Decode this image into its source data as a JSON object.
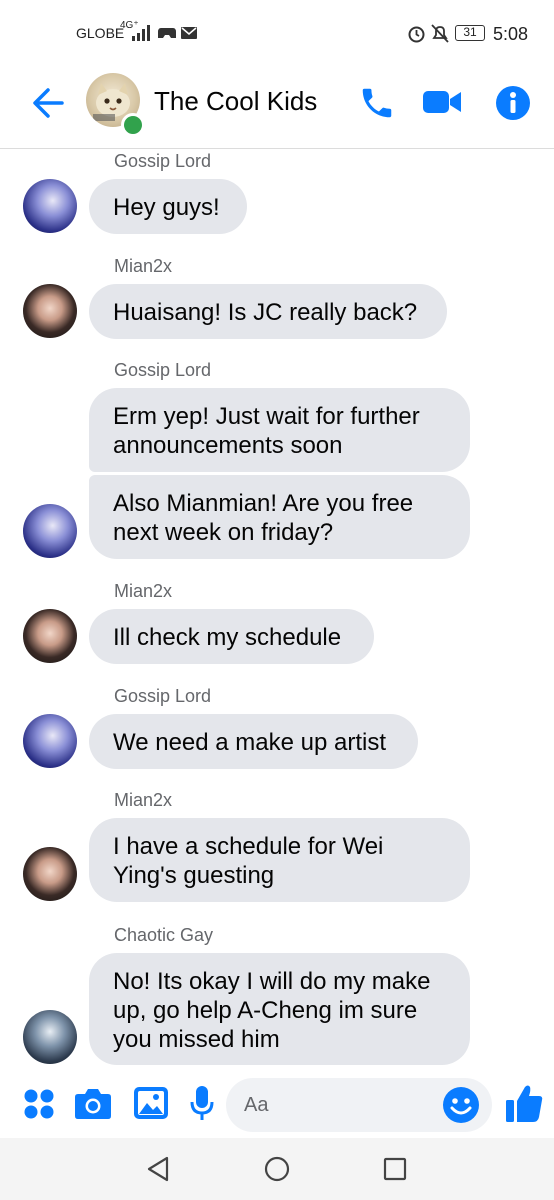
{
  "status_bar": {
    "carrier": "GLOBE",
    "network": "4G⁺",
    "battery": "31",
    "time": "5:08"
  },
  "header": {
    "title": "The Cool Kids",
    "icons": [
      "back-arrow-icon",
      "phone-icon",
      "video-camera-icon",
      "info-icon"
    ]
  },
  "messages": [
    {
      "sender": "Gossip Lord",
      "bubbles": [
        "Hey guys!"
      ]
    },
    {
      "sender": "Mian2x",
      "bubbles": [
        "Huaisang! Is JC really back?"
      ]
    },
    {
      "sender": "Gossip Lord",
      "bubbles": [
        "Erm yep! Just wait for further\nannouncements soon",
        "Also Mianmian! Are you free\nnext week on friday?"
      ]
    },
    {
      "sender": "Mian2x",
      "bubbles": [
        "Ill check my schedule"
      ]
    },
    {
      "sender": "Gossip Lord",
      "bubbles": [
        "We need a make up artist"
      ]
    },
    {
      "sender": "Mian2x",
      "bubbles": [
        "I have a schedule for Wei\nYing's guesting"
      ]
    },
    {
      "sender": "Chaotic Gay",
      "bubbles": [
        "No! Its okay I will do my make\nup, go help A-Cheng im sure\nyou missed him"
      ]
    }
  ],
  "composer": {
    "placeholder": "Aa",
    "icons": [
      "apps-icon",
      "camera-icon",
      "gallery-icon",
      "microphone-icon",
      "emoji-icon",
      "thumbs-up-icon"
    ]
  },
  "colors": {
    "accent": "#0a7cff",
    "bubble": "#e4e6eb",
    "online": "#31a24c"
  }
}
